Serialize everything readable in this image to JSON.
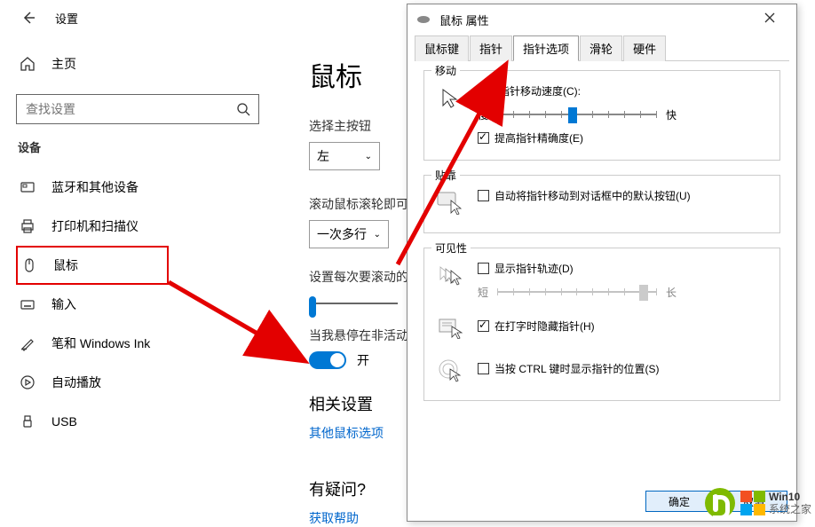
{
  "settings": {
    "title": "设置",
    "home": "主页",
    "search_placeholder": "查找设置",
    "devices_heading": "设备",
    "nav": [
      {
        "id": "bluetooth",
        "label": "蓝牙和其他设备"
      },
      {
        "id": "printers",
        "label": "打印机和扫描仪"
      },
      {
        "id": "mouse",
        "label": "鼠标"
      },
      {
        "id": "typing",
        "label": "输入"
      },
      {
        "id": "pen",
        "label": "笔和 Windows Ink"
      },
      {
        "id": "autoplay",
        "label": "自动播放"
      },
      {
        "id": "usb",
        "label": "USB"
      }
    ]
  },
  "main": {
    "title": "鼠标",
    "select_primary_label": "选择主按钮",
    "primary_value": "左",
    "scroll_label": "滚动鼠标滚轮即可",
    "scroll_value": "一次多行",
    "lines_label": "设置每次要滚动的",
    "hover_label": "当我悬停在非活动",
    "toggle_on": "开",
    "related_heading": "相关设置",
    "other_mouse": "其他鼠标选项",
    "question_heading": "有疑问?",
    "get_help": "获取帮助"
  },
  "dialog": {
    "title": "鼠标 属性",
    "tabs": [
      "鼠标键",
      "指针",
      "指针选项",
      "滑轮",
      "硬件"
    ],
    "active_tab": 2,
    "motion_group": "移动",
    "motion_text": "选择指针移动速度(C):",
    "slow": "慢",
    "fast": "快",
    "enhance_precision": "提高指针精确度(E)",
    "snap_group": "贴靠",
    "snap_text": "自动将指针移动到对话框中的默认按钮(U)",
    "visibility_group": "可见性",
    "trail_text": "显示指针轨迹(D)",
    "short": "短",
    "long": "长",
    "hide_typing": "在打字时隐藏指针(H)",
    "ctrl_locate": "当按 CTRL 键时显示指针的位置(S)",
    "ok": "确定",
    "cancel": "取消"
  },
  "watermark": {
    "line1": "Win10",
    "line2": "系统之家"
  }
}
